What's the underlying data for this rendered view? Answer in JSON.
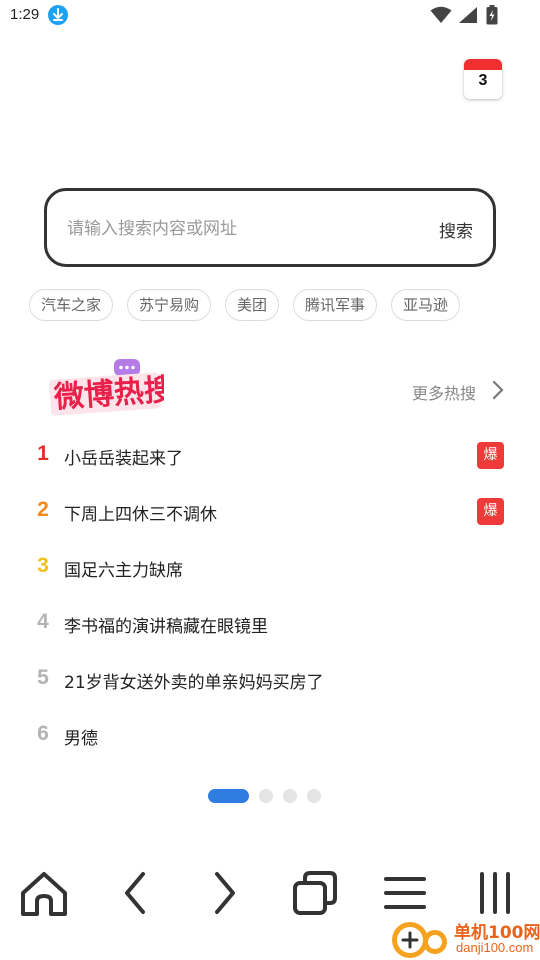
{
  "status_bar": {
    "time": "1:29",
    "icons": [
      "download-icon",
      "wifi-icon",
      "signal-icon",
      "battery-icon"
    ]
  },
  "calendar": {
    "day": "3",
    "icon": "calendar-icon"
  },
  "search": {
    "placeholder": "请输入搜索内容或网址",
    "value": "",
    "button_label": "搜索"
  },
  "quick_links": [
    "汽车之家",
    "苏宁易购",
    "美团",
    "腾讯军事",
    "亚马逊"
  ],
  "hot": {
    "logo_text": "微博热搜",
    "more_label": "更多热搜",
    "items": [
      {
        "rank": "1",
        "title": "小岳岳装起来了",
        "badge": "爆",
        "rank_color": "#ee2b2b"
      },
      {
        "rank": "2",
        "title": "下周上四休三不调休",
        "badge": "爆",
        "rank_color": "#f08a1c"
      },
      {
        "rank": "3",
        "title": "国足六主力缺席",
        "badge": "",
        "rank_color": "#f2c11a"
      },
      {
        "rank": "4",
        "title": "李书福的演讲稿藏在眼镜里",
        "badge": "",
        "rank_color": "#b3b3b3"
      },
      {
        "rank": "5",
        "title": "21岁背女送外卖的单亲妈妈买房了",
        "badge": "",
        "rank_color": "#b3b3b3"
      },
      {
        "rank": "6",
        "title": "男德",
        "badge": "",
        "rank_color": "#b3b3b3"
      }
    ],
    "badge_color": "#ef3a3a"
  },
  "pager": {
    "pages": 4,
    "active": 1,
    "active_color": "#2f7de1"
  },
  "bottom_nav": [
    "home-icon",
    "back-icon",
    "forward-icon",
    "tabs-icon",
    "menu-icon",
    "more-icon"
  ],
  "watermark": {
    "line1": "单机100网",
    "line2": "danji100.com"
  }
}
